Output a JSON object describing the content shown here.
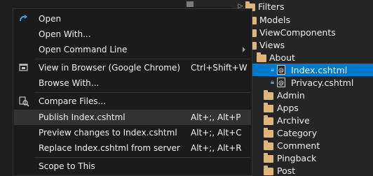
{
  "context_menu": {
    "items": [
      {
        "label": "Open",
        "shortcut": "",
        "icon": "redo-arrow-icon"
      },
      {
        "label": "Open With...",
        "shortcut": ""
      },
      {
        "label": "Open Command Line",
        "shortcut": "",
        "submenu": true
      },
      {
        "label": "View in Browser (Google Chrome)",
        "shortcut": "Ctrl+Shift+W",
        "icon": "browser-icon"
      },
      {
        "label": "Browse With...",
        "shortcut": ""
      },
      {
        "label": "Compare Files...",
        "shortcut": "",
        "icon": "compare-icon"
      },
      {
        "label": "Publish Index.cshtml",
        "shortcut": "Alt+;, Alt+P"
      },
      {
        "label": "Preview changes to Index.cshtml",
        "shortcut": "Alt+;, Alt+C"
      },
      {
        "label": "Replace Index.cshtml from server",
        "shortcut": "Alt+;, Alt+R"
      },
      {
        "label": "Scope to This",
        "shortcut": ""
      }
    ]
  },
  "solution_explorer": {
    "items": [
      {
        "label": "Filters",
        "type": "folder",
        "icon": "folder-icon"
      },
      {
        "label": "Models",
        "type": "folder",
        "icon": "folder-icon"
      },
      {
        "label": "ViewComponents",
        "type": "folder",
        "icon": "folder-icon"
      },
      {
        "label": "Views",
        "type": "folder",
        "icon": "folder-icon"
      },
      {
        "label": "About",
        "type": "folder",
        "icon": "folder-icon"
      },
      {
        "label": "Index.cshtml",
        "type": "file",
        "icon": "cshtml-file-icon",
        "selected": true
      },
      {
        "label": "Privacy.cshtml",
        "type": "file",
        "icon": "cshtml-file-icon"
      },
      {
        "label": "Admin",
        "type": "folder",
        "icon": "folder-icon"
      },
      {
        "label": "Apps",
        "type": "folder",
        "icon": "folder-icon"
      },
      {
        "label": "Archive",
        "type": "folder",
        "icon": "folder-icon"
      },
      {
        "label": "Category",
        "type": "folder",
        "icon": "folder-icon"
      },
      {
        "label": "Comment",
        "type": "folder",
        "icon": "folder-icon"
      },
      {
        "label": "Pingback",
        "type": "folder",
        "icon": "folder-icon"
      },
      {
        "label": "Post",
        "type": "folder",
        "icon": "folder-icon"
      }
    ]
  },
  "colors": {
    "menu_bg": "#1b1b1c",
    "menu_hover": "#333334",
    "selection": "#007acc",
    "folder": "#dcb67a",
    "lock": "#62aef0"
  }
}
